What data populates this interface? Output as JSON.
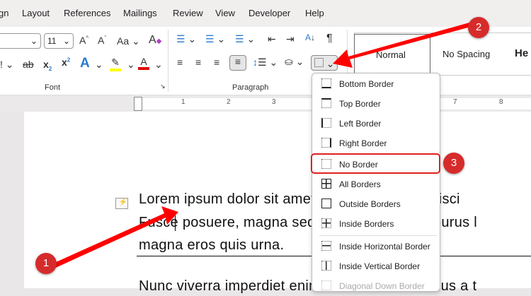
{
  "tabs": [
    "gn",
    "Layout",
    "References",
    "Mailings",
    "Review",
    "View",
    "Developer",
    "Help"
  ],
  "ribbon": {
    "font_size": "11",
    "font_group": "Font",
    "paragraph_group": "Paragraph",
    "styles": [
      "Normal",
      "No Spacing",
      "He"
    ],
    "colors": {
      "highlight": "#ffff00",
      "font_color": "#e00000"
    }
  },
  "ruler": {
    "numbers": [
      "1",
      "2",
      "3",
      "7",
      "8"
    ]
  },
  "document": {
    "lines": [
      "Lorem ipsum dolor sit amet, consectetuer adipisci",
      "Fusce posuere, magna sed pulvinar ultricies, purus l",
      "magna eros quis urna.",
      "Nunc viverra imperdiet enim. Fusce est. Vivamus a t"
    ]
  },
  "border_menu": {
    "items": [
      "Bottom Border",
      "Top Border",
      "Left Border",
      "Right Border",
      "No Border",
      "All Borders",
      "Outside Borders",
      "Inside Borders",
      "Inside Horizontal Border",
      "Inside Vertical Border",
      "Diagonal Down Border"
    ],
    "highlighted": "No Border"
  },
  "annotations": [
    "1",
    "2",
    "3"
  ],
  "accent": "#e02020"
}
